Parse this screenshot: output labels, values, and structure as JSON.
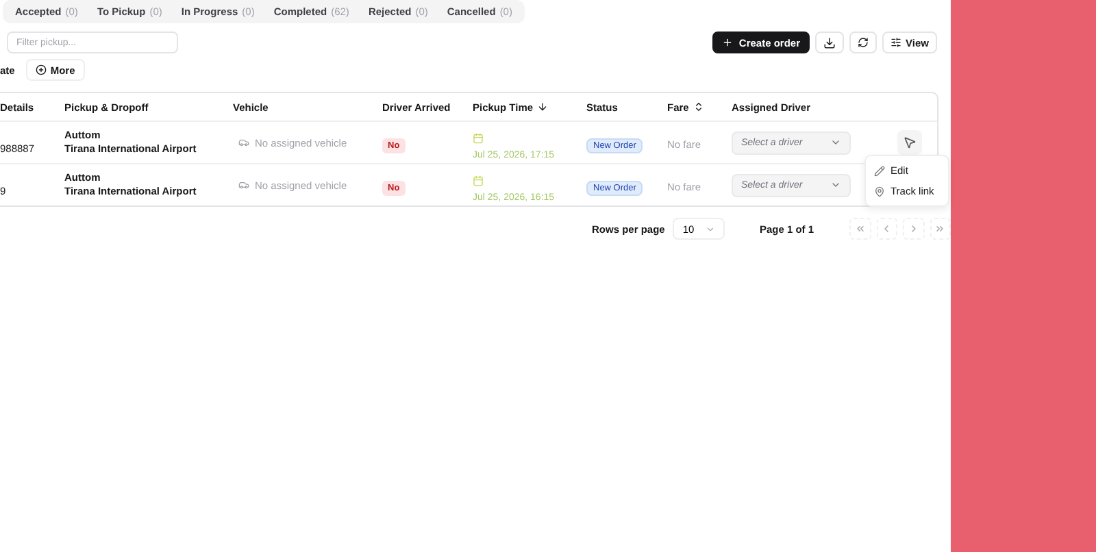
{
  "status_tabs": [
    {
      "label": "Accepted",
      "count": "(0)",
      "selected": false
    },
    {
      "label": "To Pickup",
      "count": "(0)",
      "selected": false
    },
    {
      "label": "In Progress",
      "count": "(0)",
      "selected": false
    },
    {
      "label": "Completed",
      "count": "(62)",
      "selected": false
    },
    {
      "label": "Rejected",
      "count": "(0)",
      "selected": false
    },
    {
      "label": "Cancelled",
      "count": "(0)",
      "selected": false
    }
  ],
  "filter": {
    "placeholder": "Filter pickup..."
  },
  "filter_chips": [
    {
      "label": "ate",
      "kind": "plain"
    },
    {
      "label": "More",
      "kind": "add"
    }
  ],
  "toolbar": {
    "create_label": "Create order",
    "view_label": "View"
  },
  "table": {
    "columns": [
      {
        "label": "Details",
        "kind": "plain"
      },
      {
        "label": "Pickup & Dropoff",
        "kind": "plain"
      },
      {
        "label": "Vehicle",
        "kind": "plain"
      },
      {
        "label": "Driver Arrived",
        "kind": "plain"
      },
      {
        "label": "Pickup Time",
        "kind": "sorted"
      },
      {
        "label": "Status",
        "kind": "plain"
      },
      {
        "label": "Fare",
        "kind": "sortable"
      },
      {
        "label": "Assigned Driver",
        "kind": "plain"
      }
    ],
    "rows": [
      {
        "details": "988887",
        "pickup": "Auttom",
        "dropoff": "Tirana International Airport",
        "vehicle": "No assigned vehicle",
        "driver_arrived": "No",
        "pickup_time": "Jul 25, 2026, 17:15",
        "status": "New Order",
        "fare": "No fare",
        "driver_placeholder": "Select a driver",
        "menu_open": true
      },
      {
        "details": "9",
        "pickup": "Auttom",
        "dropoff": "Tirana International Airport",
        "vehicle": "No assigned vehicle",
        "driver_arrived": "No",
        "pickup_time": "Jul 25, 2026, 16:15",
        "status": "New Order",
        "fare": "No fare",
        "driver_placeholder": "Select a driver",
        "menu_open": false
      }
    ]
  },
  "row_menu": {
    "items": [
      {
        "label": "Edit",
        "kind": "edit"
      },
      {
        "label": "Track link",
        "kind": "track"
      }
    ]
  },
  "pagination": {
    "rows_per_page_label": "Rows per page",
    "rows_per_page": "10",
    "page_label": "Page 1 of 1"
  }
}
